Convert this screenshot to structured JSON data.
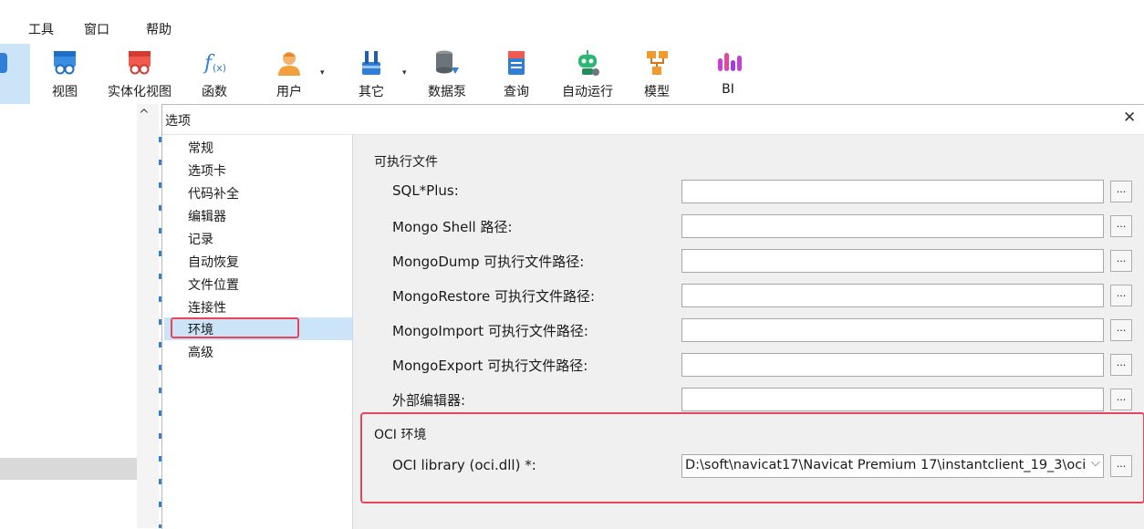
{
  "menu": {
    "items": [
      "工具",
      "窗口",
      "帮助"
    ]
  },
  "toolbar": {
    "buttons": [
      {
        "label": "视图",
        "icon": "view-icon"
      },
      {
        "label": "实体化视图",
        "icon": "materialized-view-icon"
      },
      {
        "label": "函数",
        "icon": "function-icon"
      },
      {
        "label": "用户",
        "icon": "user-icon"
      },
      {
        "label": "其它",
        "icon": "tools-icon"
      },
      {
        "label": "数据泵",
        "icon": "data-pump-icon"
      },
      {
        "label": "查询",
        "icon": "query-icon"
      },
      {
        "label": "自动运行",
        "icon": "automation-robot-icon"
      },
      {
        "label": "模型",
        "icon": "model-icon"
      },
      {
        "label": "BI",
        "icon": "bi-icon"
      }
    ],
    "partial_label": "",
    "dropdown_glyph": "▾"
  },
  "dialog": {
    "title": "选项",
    "close_glyph": "✕",
    "categories": [
      "常规",
      "选项卡",
      "代码补全",
      "编辑器",
      "记录",
      "自动恢复",
      "文件位置",
      "连接性",
      "环境",
      "高级"
    ],
    "selected_category": "环境",
    "section_executables": "可执行文件",
    "rows": [
      {
        "label": "SQL*Plus:",
        "value": ""
      },
      {
        "label": "Mongo Shell 路径:",
        "value": ""
      },
      {
        "label": "MongoDump 可执行文件路径:",
        "value": ""
      },
      {
        "label": "MongoRestore 可执行文件路径:",
        "value": ""
      },
      {
        "label": "MongoImport 可执行文件路径:",
        "value": ""
      },
      {
        "label": "MongoExport 可执行文件路径:",
        "value": ""
      },
      {
        "label": "外部编辑器:",
        "value": ""
      }
    ],
    "browse_label": "...",
    "section_oci": "OCI 环境",
    "oci": {
      "label": "OCI library (oci.dll) *:",
      "value": "D:\\soft\\navicat17\\Navicat Premium 17\\instantclient_19_3\\oci",
      "chevron": "⌵"
    }
  },
  "navigator": {
    "collapse_glyph": "^"
  },
  "colors": {
    "highlight_box": "#e8455b",
    "selected_bg": "#cce4f7",
    "content_bg": "#f0f0f0"
  }
}
